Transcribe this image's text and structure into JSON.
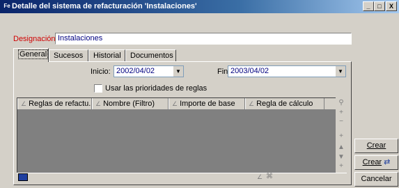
{
  "window": {
    "title": "Detalle del sistema de refacturación 'Instalaciones'",
    "minimize_glyph": "_",
    "maximize_glyph": "□",
    "close_glyph": "X"
  },
  "designation": {
    "label": "Designación:",
    "value": "Instalaciones"
  },
  "tabs": [
    {
      "label": "General",
      "active": true
    },
    {
      "label": "Sucesos",
      "active": false
    },
    {
      "label": "Historial",
      "active": false
    },
    {
      "label": "Documentos",
      "active": false
    }
  ],
  "general": {
    "inicio_label": "Inicio:",
    "inicio_value": "2002/04/02",
    "fin_label": "Fin:",
    "fin_value": "2003/04/02",
    "use_priorities_label": "Usar las prioridades de reglas",
    "use_priorities_checked": false
  },
  "grid": {
    "columns": [
      "Reglas de refactu...",
      "Nombre (Filtro)",
      "Importe de base",
      "Regla de cálculo"
    ],
    "rows": []
  },
  "buttons": {
    "create": "Crear",
    "create_more": "Crear",
    "cancel": "Cancelar"
  },
  "icons": {
    "app": "app-icon",
    "search": "magnifier-icon",
    "add": "plus-icon",
    "remove": "minus-icon",
    "up": "arrow-up-icon",
    "down": "arrow-down-icon"
  }
}
